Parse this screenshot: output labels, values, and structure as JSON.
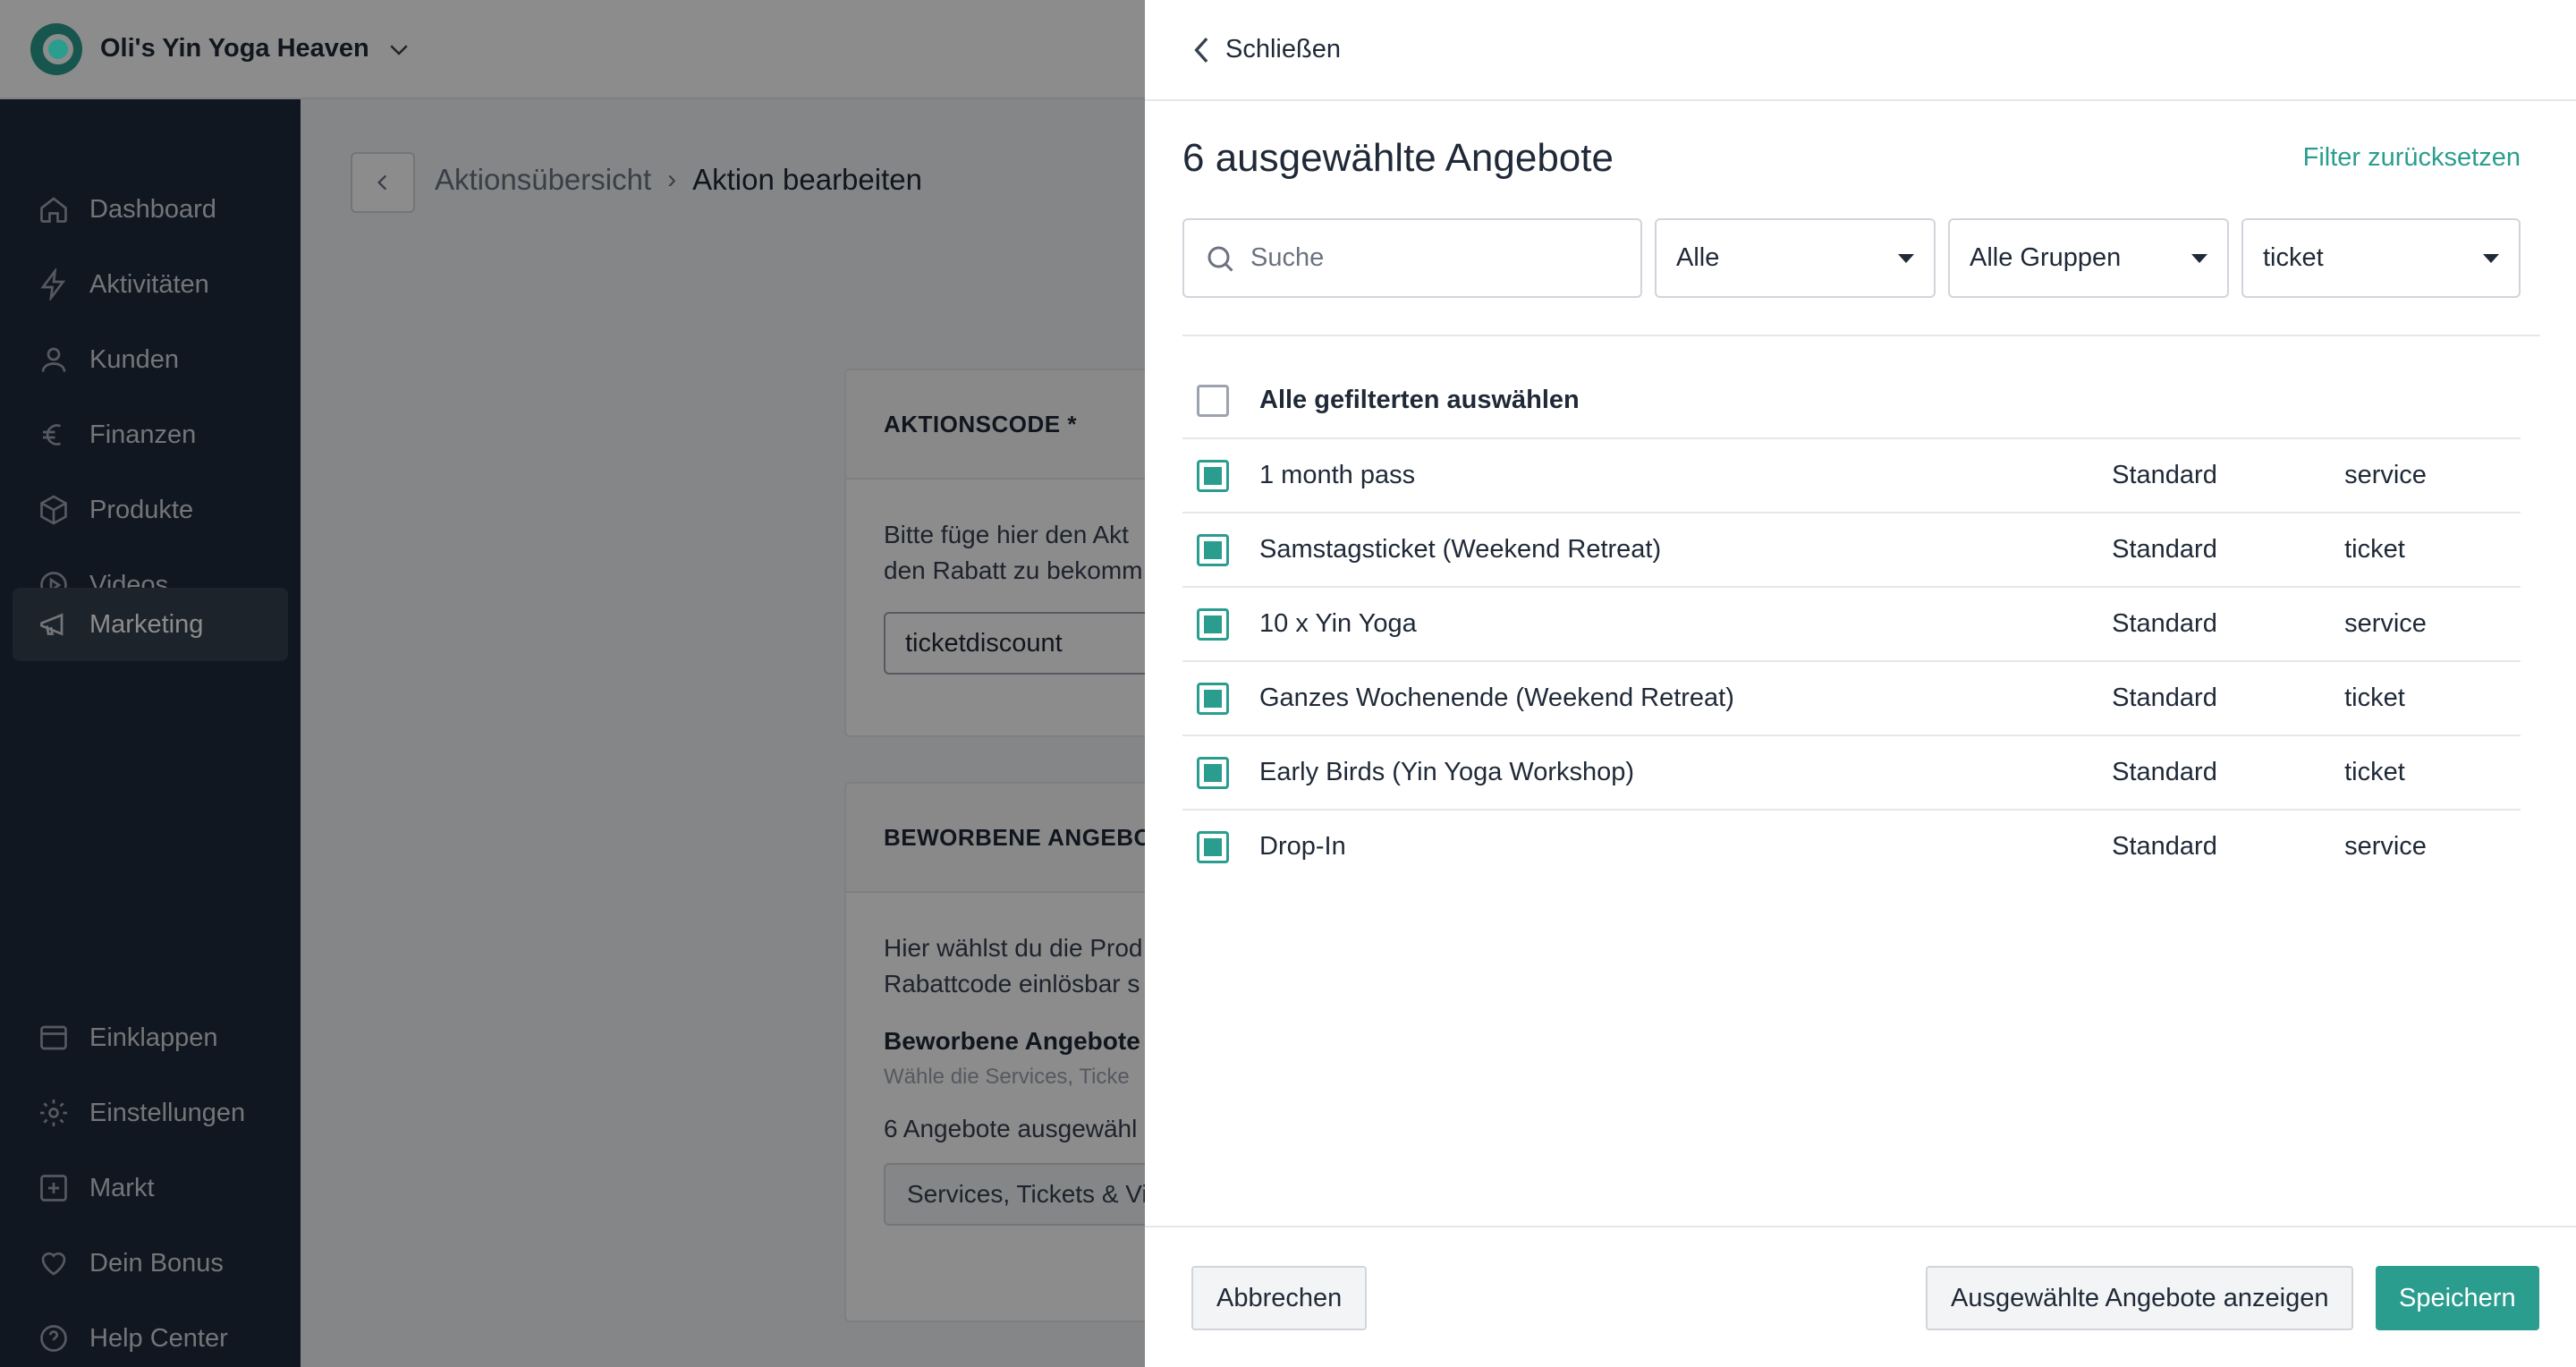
{
  "app": {
    "studio_name": "Oli's Yin Yoga Heaven"
  },
  "sidebar": {
    "items": [
      {
        "label": "Dashboard",
        "icon": "home-icon"
      },
      {
        "label": "Aktivitäten",
        "icon": "bolt-icon"
      },
      {
        "label": "Kunden",
        "icon": "user-icon"
      },
      {
        "label": "Finanzen",
        "icon": "euro-icon"
      },
      {
        "label": "Produkte",
        "icon": "box-icon"
      },
      {
        "label": "Videos",
        "icon": "play-icon"
      },
      {
        "label": "Marketing",
        "icon": "megaphone-icon",
        "active": true
      }
    ],
    "bottom_items": [
      {
        "label": "Einklappen",
        "icon": "collapse-icon"
      },
      {
        "label": "Einstellungen",
        "icon": "gear-icon"
      },
      {
        "label": "Markt",
        "icon": "plus-square-icon"
      },
      {
        "label": "Dein Bonus",
        "icon": "heart-icon"
      },
      {
        "label": "Help Center",
        "icon": "help-icon"
      }
    ]
  },
  "breadcrumb": {
    "parent": "Aktionsübersicht",
    "current": "Aktion bearbeiten"
  },
  "code_card": {
    "title": "AKTIONSCODE *",
    "description_line1": "Bitte füge hier den Akt",
    "description_line2": "den Rabatt zu bekomm",
    "code_value": "ticketdiscount"
  },
  "offers_card": {
    "title": "BEWORBENE ANGEBOTE",
    "description_line1": "Hier wählst du die Prod",
    "description_line2": "Rabattcode einlösbar s",
    "subtitle": "Beworbene Angebote",
    "hint": "Wähle die Services, Ticke",
    "count_text": "6 Angebote ausgewähl",
    "select_text": "Services, Tickets & Vi"
  },
  "drawer": {
    "close_label": "Schließen",
    "title": "6 ausgewählte Angebote",
    "reset_label": "Filter zurücksetzen",
    "search_placeholder": "Suche",
    "filter_status": "Alle",
    "filter_group": "Alle Gruppen",
    "filter_type": "ticket",
    "select_all_label": "Alle gefilterten auswählen",
    "rows": [
      {
        "name": "1 month pass",
        "group": "Standard",
        "type": "service",
        "checked": true
      },
      {
        "name": "Samstagsticket (Weekend Retreat)",
        "group": "Standard",
        "type": "ticket",
        "checked": true
      },
      {
        "name": "10 x Yin Yoga",
        "group": "Standard",
        "type": "service",
        "checked": true
      },
      {
        "name": "Ganzes Wochenende (Weekend Retreat)",
        "group": "Standard",
        "type": "ticket",
        "checked": true
      },
      {
        "name": "Early Birds (Yin Yoga Workshop)",
        "group": "Standard",
        "type": "ticket",
        "checked": true
      },
      {
        "name": "Drop-In",
        "group": "Standard",
        "type": "service",
        "checked": true
      }
    ],
    "cancel_label": "Abbrechen",
    "show_selected_label": "Ausgewählte Angebote anzeigen",
    "save_label": "Speichern"
  },
  "colors": {
    "accent": "#2a9d8f",
    "sidebar_bg": "#1f2a3c"
  }
}
